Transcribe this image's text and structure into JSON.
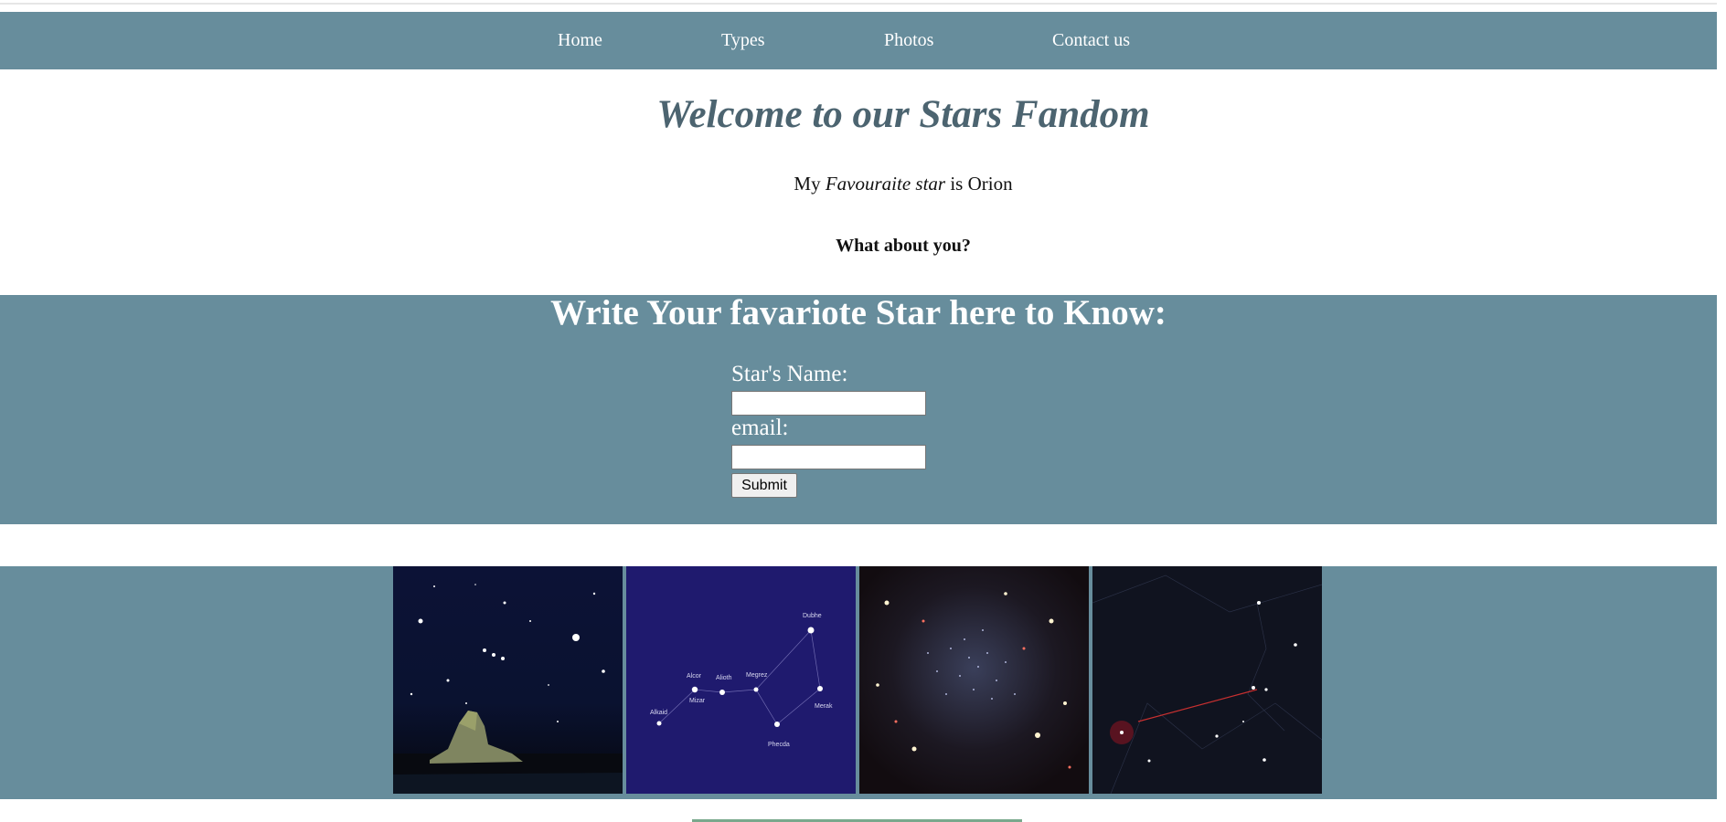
{
  "nav": {
    "items": [
      {
        "label": "Home"
      },
      {
        "label": "Types"
      },
      {
        "label": "Photos"
      },
      {
        "label": "Contact us"
      }
    ]
  },
  "hero": {
    "title": "Welcome to our Stars Fandom",
    "fav_prefix": "My",
    "fav_emph": "Favouraite star",
    "fav_suffix": "is Orion",
    "question": "What about you?"
  },
  "form": {
    "heading": "Write Your favariote Star here to Know:",
    "name_label": "Star's Name:",
    "name_value": "",
    "email_label": "email:",
    "email_value": "",
    "submit_label": "Submit"
  },
  "gallery": {
    "photos": [
      {
        "icon": "night-sky-rock-photo"
      },
      {
        "icon": "big-dipper-chart-photo",
        "labels": [
          "Dubhe",
          "Alcor",
          "Alioth",
          "Megrez",
          "Mizar",
          "Merak",
          "Alkaid",
          "Phecda"
        ]
      },
      {
        "icon": "star-cluster-photo"
      },
      {
        "icon": "constellation-map-photo"
      }
    ]
  },
  "colors": {
    "band": "#678d9c",
    "title": "#4c6470",
    "footer_accent": "#79a88c"
  }
}
